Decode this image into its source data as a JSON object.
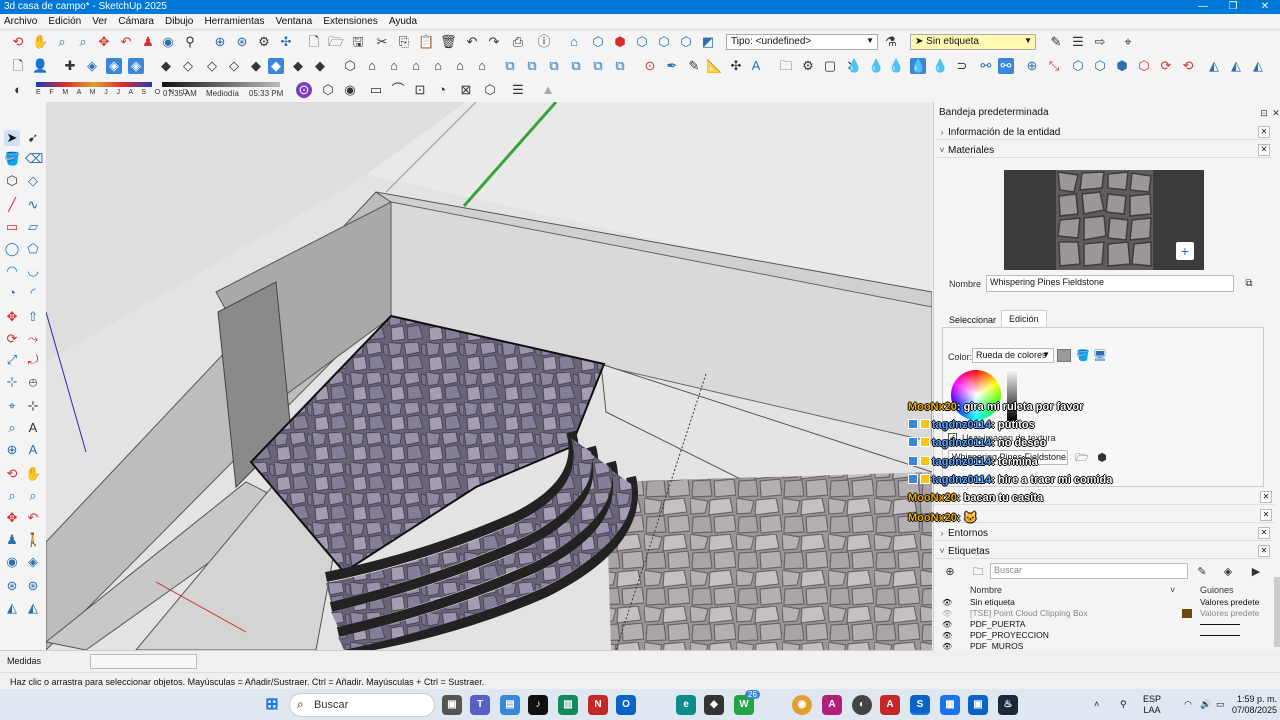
{
  "window": {
    "title": "3d casa de campo* - SketchUp 2025"
  },
  "menu": [
    "Archivo",
    "Edición",
    "Ver",
    "Cámara",
    "Dibujo",
    "Herramientas",
    "Ventana",
    "Extensiones",
    "Ayuda"
  ],
  "toolbar": {
    "type_select": "Tipo: <undefined>",
    "tag_select": "Sin etiqueta",
    "months": "E F M A M J J A S O N D",
    "time_start": "07:35 AM",
    "time_mid": "Mediodía",
    "time_end": "05:33 PM"
  },
  "tray": {
    "title": "Bandeja predeterminada",
    "sections": {
      "entity_info": "Información de la entidad",
      "materials": "Materiales",
      "environments": "Entornos",
      "tags": "Etiquetas"
    },
    "material": {
      "name_label": "Nombre",
      "name_value": "Whispering Pines Fieldstone",
      "tabs": [
        "Seleccionar",
        "Edición"
      ],
      "color_label": "Color:",
      "color_mode": "Rueda de colores",
      "texture_checkbox": "Usar imagen de textura",
      "texture_file": "Whispering Pines Fieldstone.jpg"
    },
    "tags_panel": {
      "search_placeholder": "Buscar",
      "col_name": "Nombre",
      "col_dashes": "Guiones",
      "rows": [
        {
          "name": "Sin etiqueta",
          "dashes": "Valores predete",
          "swatch": ""
        },
        {
          "name": "[TSE] Point Cloud Clipping Box",
          "dashes": "Valores predete",
          "swatch": "#6b4a12"
        },
        {
          "name": "PDF_PUERTA",
          "dashes": "",
          "swatch": ""
        },
        {
          "name": "PDF_PROYECCION",
          "dashes": "",
          "swatch": ""
        },
        {
          "name": "PDF_MUROS",
          "dashes": "",
          "swatch": ""
        }
      ]
    }
  },
  "chat": [
    {
      "user": "MooNx20",
      "msg": ": gira mi ruleta por favor",
      "badge": "none"
    },
    {
      "user": "tagdnz0114",
      "msg": ": putitos",
      "badge": "double"
    },
    {
      "user": "tagdnz0114",
      "msg": ": no deseo",
      "badge": "double"
    },
    {
      "user": "tagdnz0114",
      "msg": ": termina",
      "badge": "double"
    },
    {
      "user": "tagdnz0114",
      "msg": ": hire a traer mi comida",
      "badge": "double"
    },
    {
      "user": "MooNx20",
      "msg": ": bacan tu casita",
      "badge": "none"
    },
    {
      "user": "MooNx20",
      "msg": ": 🐱",
      "badge": "none"
    }
  ],
  "bottom": {
    "measures_label": "Medidas",
    "status_text": "Haz clic o arrastra para seleccionar objetos. Mayúsculas = Añadir/Sustraer. Ctrl = Añadir. Mayúsculas + Ctrl = Sustraer."
  },
  "taskbar": {
    "search_label": "Buscar",
    "language": "ESP",
    "region": "LAA",
    "time": "1:59 p. m.",
    "date": "07/08/2025",
    "notification_count": "26"
  }
}
